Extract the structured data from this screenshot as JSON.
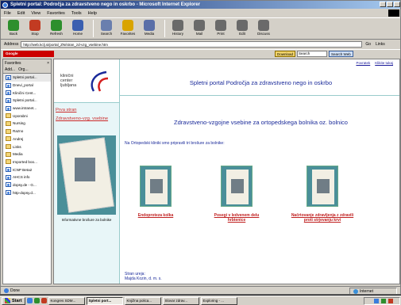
{
  "window": {
    "title": "Spletni portal: Področja za zdravstveno nego in oskrbo - Microsoft Internet Explorer"
  },
  "menu": [
    "File",
    "Edit",
    "View",
    "Favorites",
    "Tools",
    "Help"
  ],
  "toolbar": [
    {
      "label": "Back",
      "icon": "back-arrow-icon",
      "color": "#2d8f2d"
    },
    {
      "label": "Stop",
      "icon": "stop-icon",
      "color": "#c23b22"
    },
    {
      "label": "Refresh",
      "icon": "refresh-icon",
      "color": "#2d8f2d"
    },
    {
      "label": "Home",
      "icon": "home-icon",
      "color": "#3a5fb0"
    },
    {
      "label": "Search",
      "icon": "search-icon",
      "color": "#6a7fae"
    },
    {
      "label": "Favorites",
      "icon": "favorites-icon",
      "color": "#d9a400"
    },
    {
      "label": "Media",
      "icon": "media-icon",
      "color": "#5a6fa8"
    },
    {
      "label": "History",
      "icon": "history-icon",
      "color": "#6a6a6a"
    },
    {
      "label": "Mail",
      "icon": "mail-icon",
      "color": "#6a6a6a"
    },
    {
      "label": "Print",
      "icon": "print-icon",
      "color": "#6a6a6a"
    },
    {
      "label": "Edit",
      "icon": "edit-icon",
      "color": "#6a6a6a"
    },
    {
      "label": "Discuss",
      "icon": "discuss-icon",
      "color": "#6a6a6a"
    }
  ],
  "address": {
    "label": "Address",
    "url": "http://web.kclj.si/portal_ZN/stran_zd-vzg_vsebine.htm",
    "go": "Go",
    "links": "Links"
  },
  "googlebar": {
    "logo": "Google",
    "button": "Download",
    "search_placeholder": "Search",
    "search_web": "Search Web"
  },
  "favorites": {
    "title": "Favorites",
    "add": "Add...",
    "organize": "Org...",
    "items": [
      {
        "label": "Spletni portal...",
        "type": "page",
        "selected": true
      },
      {
        "label": "Dnevi_portal",
        "type": "page"
      },
      {
        "label": "Klinični Cent...",
        "type": "page"
      },
      {
        "label": "Spletni portal...",
        "type": "page"
      },
      {
        "label": "www.intranet...",
        "type": "page"
      },
      {
        "label": "Uporabni",
        "type": "folder"
      },
      {
        "label": "Nursing",
        "type": "folder"
      },
      {
        "label": "Razno",
        "type": "folder"
      },
      {
        "label": "Andrej",
        "type": "folder"
      },
      {
        "label": "Links",
        "type": "folder"
      },
      {
        "label": "Media",
        "type": "folder"
      },
      {
        "label": "Imported boo...",
        "type": "folder"
      },
      {
        "label": "ICNP Beta2",
        "type": "page"
      },
      {
        "label": "AHCS info",
        "type": "page"
      },
      {
        "label": "dopsy.de - G...",
        "type": "page"
      },
      {
        "label": "http-dopsy.d...",
        "type": "page"
      }
    ]
  },
  "page": {
    "logo_text": [
      "klinični",
      "center",
      "ljubljana"
    ],
    "nav_links": [
      "Prva stran",
      "Zdravstveno-vzg. vsebine"
    ],
    "photo_caption": "Informativne brošure za bolnike",
    "top_links": [
      "Povratek",
      "Klikite tukaj"
    ],
    "portal_title": "Spletni portal  Področja  za zdravstveno nego in oskrbo",
    "subtitle": "Zdravstveno-vzgojne vsebine za ortopedskega bolnika oz. bolnico",
    "intro": "Na Ortopedski kliniki smo pripravili tri brošure za bolnike:",
    "brochures": [
      {
        "caption": "Endoproteza kolka"
      },
      {
        "caption": "Posegi v ledvenem delu hrbtenice"
      },
      {
        "caption": "Načrtovanje zdravljenja z zdravili proti strjevanju krvi"
      }
    ],
    "footer": [
      "Stran ureja:",
      "Majda Kozin, d. m. s."
    ]
  },
  "status": {
    "text": "Done",
    "zone": "Internet"
  },
  "taskbar": {
    "start": "Start",
    "tasks": [
      {
        "label": "Kongres SDM...",
        "active": false
      },
      {
        "label": "Spletni port...",
        "active": true
      },
      {
        "label": "Knjižna polica...",
        "active": false
      },
      {
        "label": "Slovar zdrav...",
        "active": false
      },
      {
        "label": "Exploring - ...",
        "active": false
      }
    ]
  }
}
